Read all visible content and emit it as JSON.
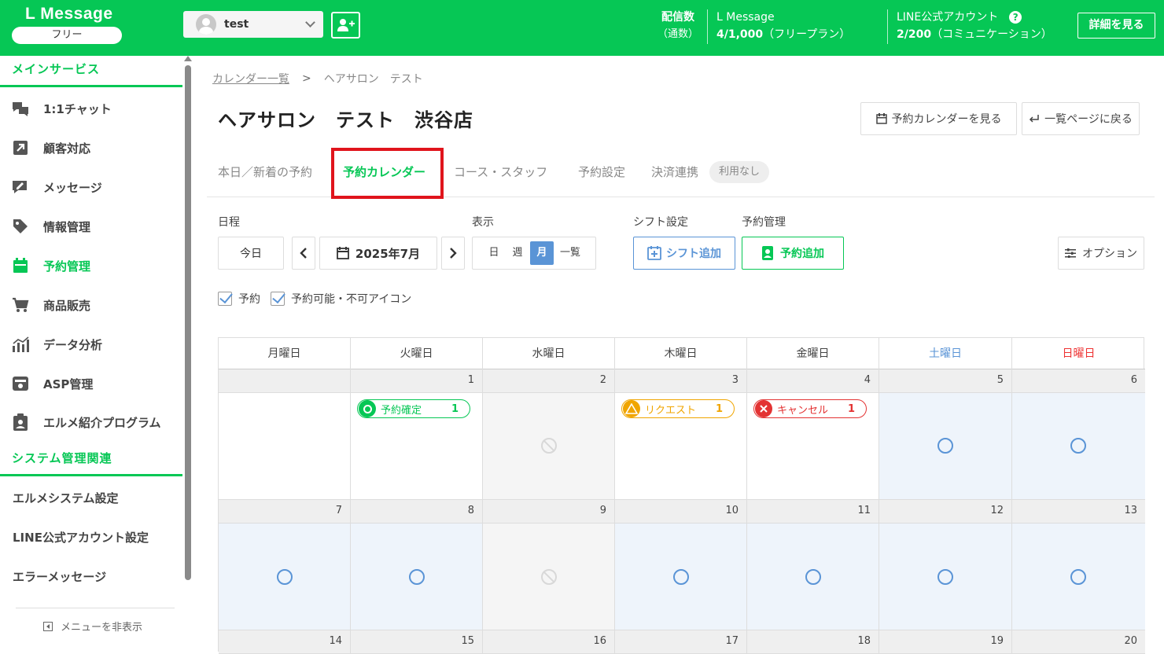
{
  "header": {
    "logo": "L Message",
    "plan": "フリー",
    "account": "test",
    "delivery_label": "配信数",
    "delivery_sub": "（通数）",
    "lmessage_label": "L Message",
    "lmessage_value": "4/1,000",
    "lmessage_plan": "（フリープラン）",
    "line_label": "LINE公式アカウント",
    "line_value": "2/200",
    "line_plan": "（コミュニケーション）",
    "help": "?",
    "detail_button": "詳細を見る"
  },
  "sidebar": {
    "section_main": "メインサービス",
    "items": [
      {
        "label": "1:1チャット",
        "icon": "chat-icon"
      },
      {
        "label": "顧客対応",
        "icon": "arrow-icon"
      },
      {
        "label": "メッセージ",
        "icon": "message-icon"
      },
      {
        "label": "情報管理",
        "icon": "tag-icon"
      },
      {
        "label": "予約管理",
        "icon": "calendar-icon"
      },
      {
        "label": "商品販売",
        "icon": "cart-icon"
      },
      {
        "label": "データ分析",
        "icon": "chart-icon"
      },
      {
        "label": "ASP管理",
        "icon": "asp-icon"
      },
      {
        "label": "エルメ紹介プログラム",
        "icon": "clipboard-icon"
      }
    ],
    "section_system": "システム管理関連",
    "system_items": [
      "エルメシステム設定",
      "LINE公式アカウント設定",
      "エラーメッセージ"
    ],
    "hide_menu": "メニューを非表示"
  },
  "breadcrumb": {
    "link": "カレンダー一覧",
    "current": "ヘアサロン　テスト"
  },
  "page": {
    "title": "ヘアサロン　テスト　渋谷店",
    "view_calendar_button": "予約カレンダーを見る",
    "back_button": "一覧ページに戻る"
  },
  "tabs": {
    "today": "本日／新着の予約",
    "calendar": "予約カレンダー",
    "course": "コース・スタッフ",
    "settings": "予約設定",
    "payment": "決済連携",
    "payment_badge": "利用なし"
  },
  "controls": {
    "schedule_label": "日程",
    "today_button": "今日",
    "month_display": "2025年7月",
    "view_label": "表示",
    "views": [
      "日",
      "週",
      "月",
      "一覧"
    ],
    "active_view": "月",
    "shift_label": "シフト設定",
    "shift_add": "シフト追加",
    "reservation_label": "予約管理",
    "reservation_add": "予約追加",
    "option_button": "オプション",
    "check_reservation": "予約",
    "check_icon": "予約可能・不可アイコン"
  },
  "calendar": {
    "weekdays": [
      "月曜日",
      "火曜日",
      "水曜日",
      "木曜日",
      "金曜日",
      "土曜日",
      "日曜日"
    ],
    "week1_dates": [
      "",
      "1",
      "2",
      "3",
      "4",
      "5",
      "6"
    ],
    "week2_dates": [
      "7",
      "8",
      "9",
      "10",
      "11",
      "12",
      "13"
    ],
    "week3_dates": [
      "14",
      "15",
      "16",
      "17",
      "18",
      "19",
      "20"
    ],
    "events": {
      "confirmed": {
        "label": "予約確定",
        "count": "1",
        "color": "#06c755"
      },
      "request": {
        "label": "リクエスト",
        "count": "1",
        "color": "#f0a500"
      },
      "cancel": {
        "label": "キャンセル",
        "count": "1",
        "color": "#e33333"
      }
    }
  }
}
